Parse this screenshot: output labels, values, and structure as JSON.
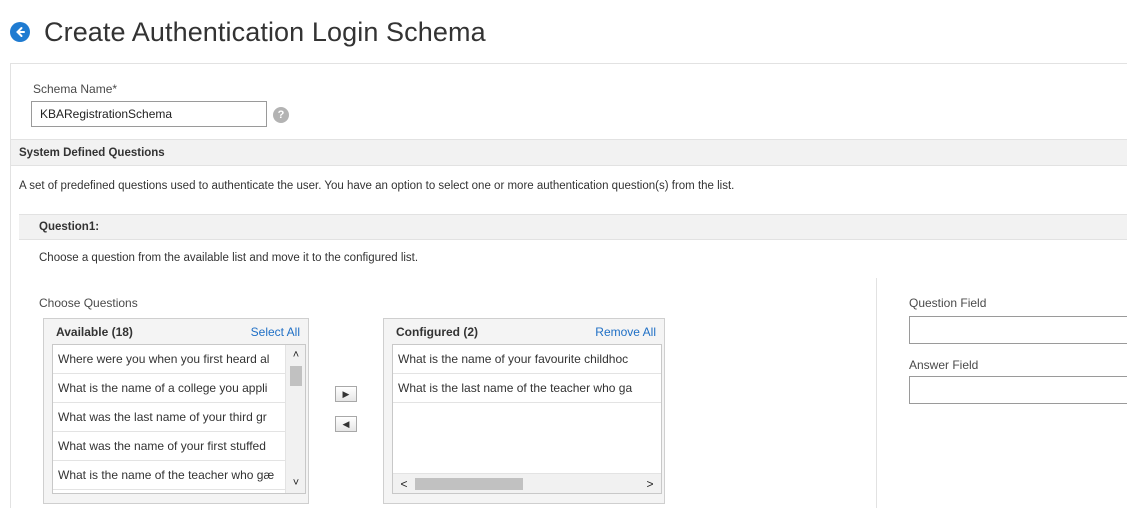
{
  "header": {
    "title": "Create Authentication Login Schema"
  },
  "schema": {
    "label": "Schema Name*",
    "value": "KBARegistrationSchema",
    "help": "?"
  },
  "system_questions": {
    "title": "System Defined Questions",
    "description": "A set of predefined questions used to authenticate the user. You have an option to select one or more authentication question(s) from the list."
  },
  "question1": {
    "title": "Question1:",
    "description": "Choose a question from the available list and move it to the configured list.",
    "choose_label": "Choose Questions",
    "available": {
      "title": "Available (18)",
      "action": "Select All",
      "items": [
        "Where were you when you first heard al",
        "What is the name of a college you appli",
        "What was the last name of your third gr",
        "What was the name of your first stuffed",
        "What is the name of the teacher who gæ"
      ]
    },
    "configured": {
      "title": "Configured (2)",
      "action": "Remove All",
      "items": [
        "What is the name of your favourite childhoc",
        "What is the last name of the teacher who ga"
      ]
    },
    "move_right": "▶",
    "move_left": "◀",
    "scroll": {
      "up": "˄",
      "down": "˅",
      "left": "<",
      "right": ">"
    },
    "question_field_label": "Question Field",
    "question_field_value": "",
    "answer_field_label": "Answer Field",
    "answer_field_value": ""
  },
  "colors": {
    "accent": "#1f7bd1",
    "link": "#1f6fc5",
    "section_bg": "#f2f2f2"
  }
}
